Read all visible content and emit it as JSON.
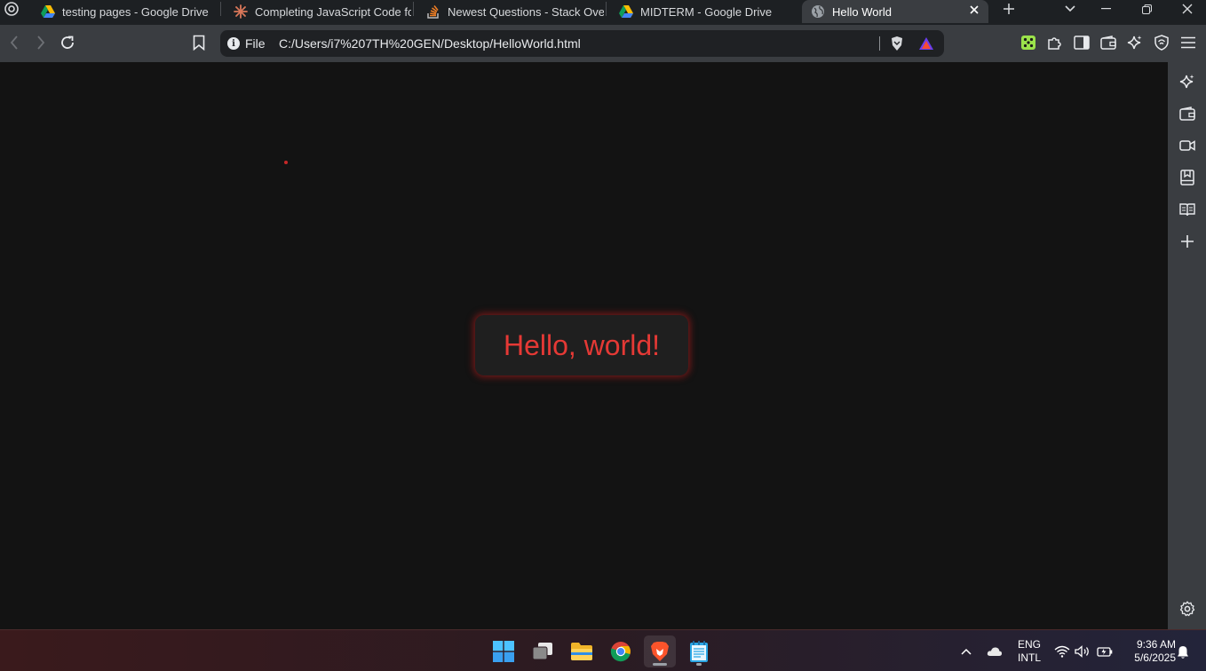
{
  "tabs": [
    {
      "title": "testing pages - Google Drive",
      "icon": "google-drive-icon"
    },
    {
      "title": "Completing JavaScript Code for",
      "icon": "claude-icon"
    },
    {
      "title": "Newest Questions - Stack Overf",
      "icon": "stack-overflow-icon"
    },
    {
      "title": "MIDTERM - Google Drive",
      "icon": "google-drive-icon"
    },
    {
      "title": "Hello World",
      "icon": "globe-icon",
      "active": true
    }
  ],
  "omnibox": {
    "site_info_label": "File",
    "url": "C:/Users/i7%207TH%20GEN/Desktop/HelloWorld.html"
  },
  "page": {
    "message": "Hello, world!",
    "accent_color": "#e53935",
    "dot_color": "#c62828"
  },
  "taskbar": {
    "language_line1": "ENG",
    "language_line2": "INTL",
    "time": "9:36 AM",
    "date": "5/6/2025"
  }
}
